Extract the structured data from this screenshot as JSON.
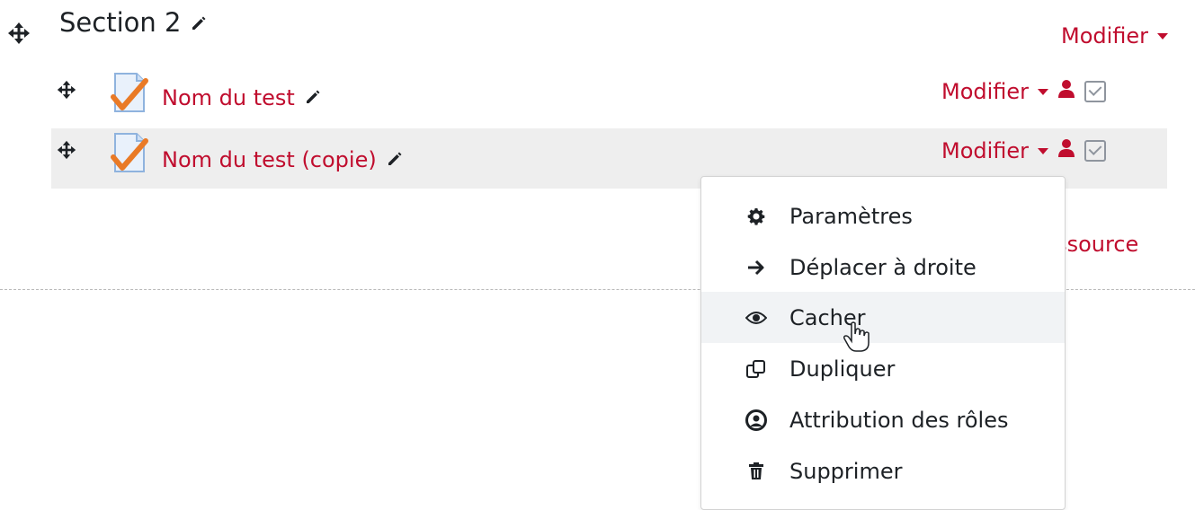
{
  "section": {
    "title": "Section 2"
  },
  "edit_menu_label": "Modifier",
  "activities": [
    {
      "name": "Nom du test"
    },
    {
      "name": "Nom du test (copie)"
    }
  ],
  "add_resource_partial": "ressource",
  "dropdown": {
    "items": [
      {
        "label": "Paramètres",
        "icon": "gear-icon"
      },
      {
        "label": "Déplacer à droite",
        "icon": "arrow-right-icon"
      },
      {
        "label": "Cacher",
        "icon": "eye-icon"
      },
      {
        "label": "Dupliquer",
        "icon": "copy-icon"
      },
      {
        "label": "Attribution des rôles",
        "icon": "user-circle-icon"
      },
      {
        "label": "Supprimer",
        "icon": "trash-icon"
      }
    ]
  },
  "colors": {
    "link": "#c00d2e",
    "hover_row": "#eeeeee"
  }
}
